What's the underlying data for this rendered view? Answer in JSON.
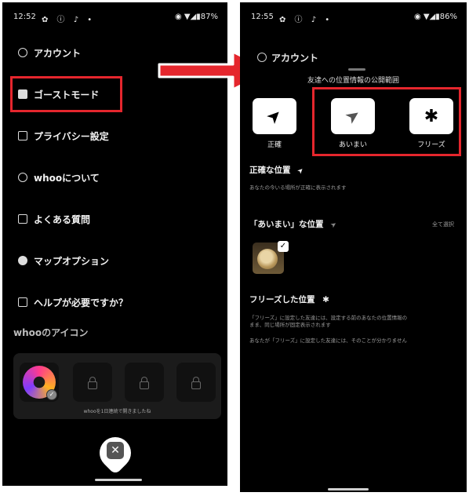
{
  "left": {
    "status": {
      "time": "12:52",
      "icons": "✿ ⓘ ♪ •",
      "right": "◉ ▼◢▮87%"
    },
    "menu": [
      {
        "label": "アカウント"
      },
      {
        "label": "ゴーストモード"
      },
      {
        "label": "プライバシー設定"
      },
      {
        "label": "whooについて"
      },
      {
        "label": "よくある質問"
      },
      {
        "label": "マップオプション"
      },
      {
        "label": "ヘルプが必要ですか？"
      }
    ],
    "icon_section_title": "whooのアイコン",
    "icon_panel_caption": "whooを1日連続で開きましたね",
    "close_symbol": "✕"
  },
  "right": {
    "status": {
      "time": "12:55",
      "icons": "✿ ⓘ ♪ •",
      "right": "◉ ▼◢▮86%"
    },
    "account_label": "アカウント",
    "sheet_title": "友達への位置情報の公開範囲",
    "options": [
      {
        "label": "正確",
        "glyph": "➤"
      },
      {
        "label": "あいまい",
        "glyph": "➤"
      },
      {
        "label": "フリーズ",
        "glyph": "✱"
      }
    ],
    "precise": {
      "title": "正確な位置",
      "desc": "あなたの今いる場所が正確に表示されます"
    },
    "vague": {
      "title": "「あいまい」な位置",
      "select_all": "全て選択"
    },
    "freeze": {
      "title": "フリーズした位置",
      "desc1": "「フリーズ」に設定した友達には、設定する前のあなたの位置情報の",
      "desc2": "まま、同じ場所が固定表示されます",
      "desc3": "あなたが「フリーズ」に設定した友達には、そのことが分かりません"
    }
  },
  "colors": {
    "highlight": "#e5262d",
    "background": "#000000"
  }
}
